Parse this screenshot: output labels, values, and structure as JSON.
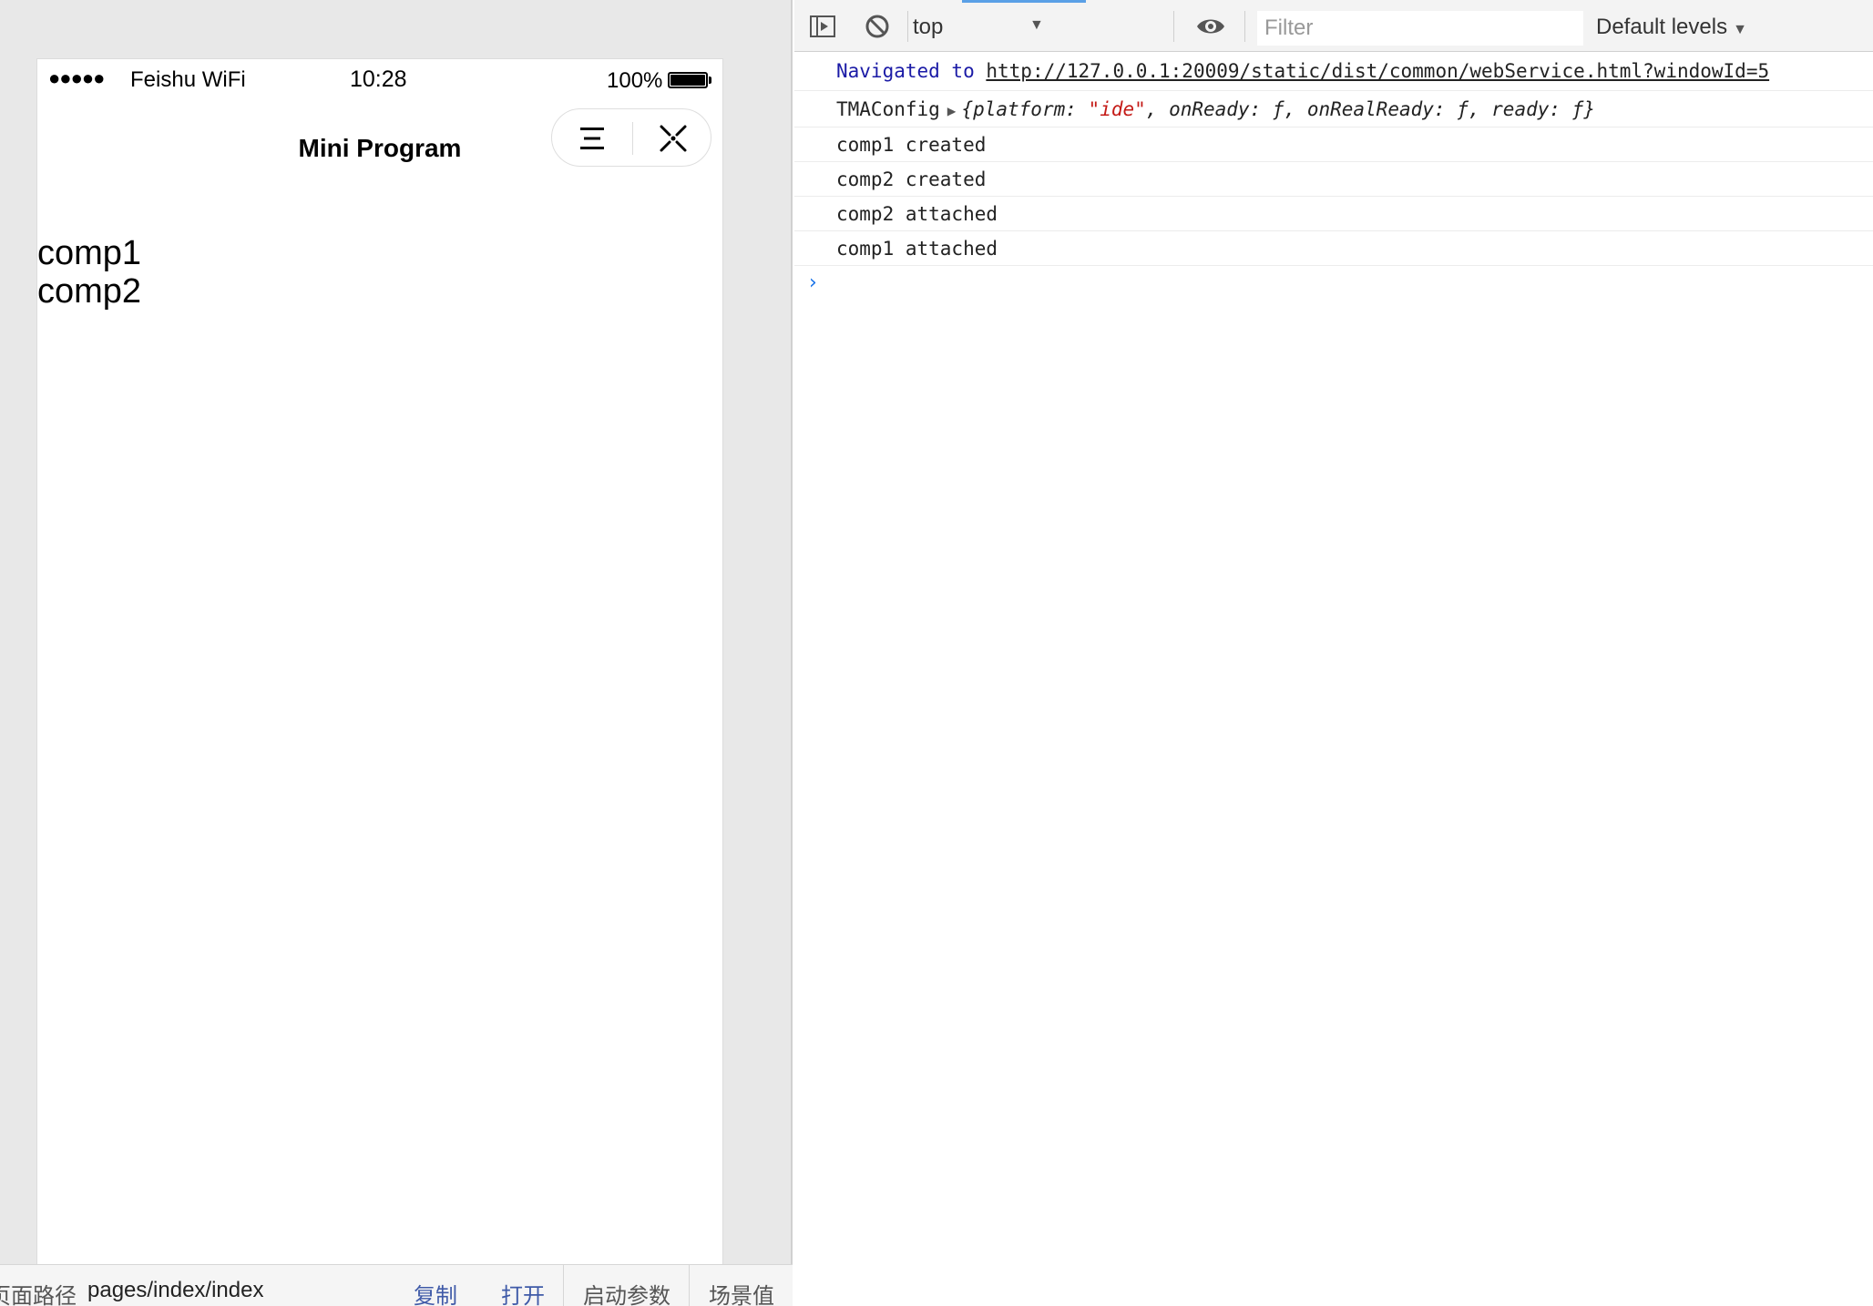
{
  "simulator": {
    "status_bar": {
      "signal": "●●●●●",
      "carrier": "Feishu WiFi",
      "time": "10:28",
      "battery_percent": "100%",
      "battery_level": 1.0
    },
    "nav_bar": {
      "title": "Mini Program",
      "menu_icon": "menu-icon",
      "close_icon": "close-icon"
    },
    "content": {
      "lines": [
        "comp1",
        "comp2"
      ]
    },
    "bottom_bar": {
      "path_label": "页面路径",
      "path_value": "pages/index/index",
      "copy_label": "复制",
      "open_label": "打开",
      "launch_params_label": "启动参数",
      "scene_label": "场景值"
    }
  },
  "devtools": {
    "toolbar": {
      "sidebar_icon": "sidebar-toggle-icon",
      "clear_icon": "clear-console-icon",
      "context": "top",
      "eye_icon": "eye-icon",
      "filter_placeholder": "Filter",
      "levels": "Default levels"
    },
    "console": {
      "navigated_text": "Navigated to",
      "navigated_url": "http://127.0.0.1:20009/static/dist/common/webService.html?windowId=5",
      "tma_label": "TMAConfig",
      "tma_object": {
        "open": "{",
        "platform_key": "platform",
        "platform_val": "\"ide\"",
        "onready_key": "onReady",
        "onrealready_key": "onRealReady",
        "ready_key": "ready",
        "fn": "ƒ",
        "close": "}"
      },
      "logs": [
        "comp1 created",
        "comp2 created",
        "comp2 attached",
        "comp1 attached"
      ],
      "prompt": "›"
    }
  },
  "colors": {
    "accent_blue": "#1a73e8",
    "link_navy": "#1a1aa6",
    "string_red": "#c41a16",
    "action_link": "#3f5aa8"
  }
}
